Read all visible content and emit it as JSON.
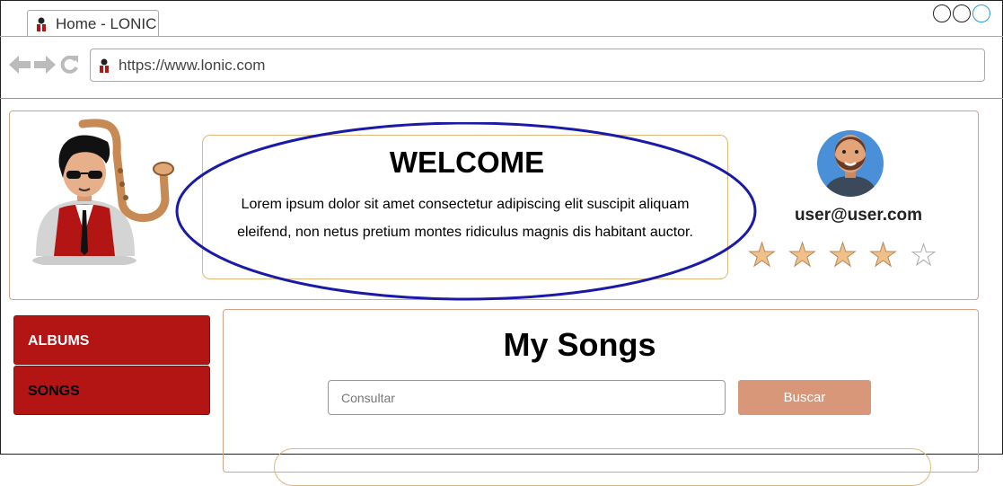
{
  "browser": {
    "tab_title": "Home - LONIC",
    "url": "https://www.lonic.com",
    "window_controls": [
      "minimize",
      "maximize",
      "close"
    ],
    "nav_icons": [
      "back-arrow-icon",
      "forward-arrow-icon",
      "reload-icon"
    ]
  },
  "header": {
    "logo": "saxophone-musician-logo",
    "welcome_title": "WELCOME",
    "welcome_text": "Lorem ipsum dolor sit amet consectetur adipiscing elit suscipit aliquam eleifend, non netus pretium montes ridiculus magnis dis habitant auctor.",
    "user": {
      "avatar": "bearded-man-avatar",
      "email": "user@user.com",
      "rating": 4,
      "rating_max": 5
    }
  },
  "sidebar": {
    "items": [
      {
        "label": "ALBUMS"
      },
      {
        "label": "SONGS"
      }
    ]
  },
  "main": {
    "title": "My Songs",
    "search": {
      "placeholder": "Consultar",
      "value": ""
    },
    "search_button": "Buscar"
  },
  "colors": {
    "sidebar_button": "#b31515",
    "search_button": "#d9977a",
    "panel_border": "#d8a088",
    "highlight_ellipse": "#1a1aa8",
    "star_fill": "#f0c08a"
  }
}
